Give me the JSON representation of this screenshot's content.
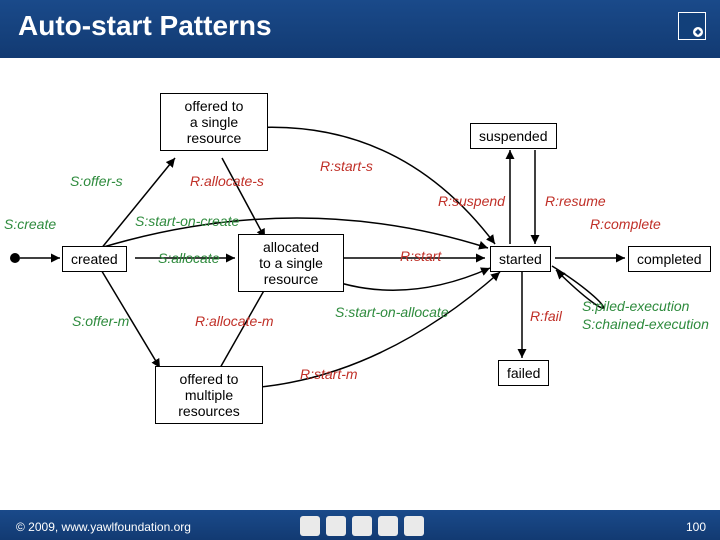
{
  "title": "Auto-start Patterns",
  "boxes": {
    "offered_single": "offered to\na single\nresource",
    "suspended": "suspended",
    "created": "created",
    "allocated_single": "allocated\nto a single\nresource",
    "started": "started",
    "completed": "completed",
    "offered_multiple": "offered to\nmultiple\nresources",
    "failed": "failed"
  },
  "labels": {
    "s_offer_s": "S:offer-s",
    "r_allocate_s": "R:allocate-s",
    "r_start_s": "R:start-s",
    "r_suspend": "R:suspend",
    "r_resume": "R:resume",
    "s_create": "S:create",
    "s_start_on_create": "S:start-on-create",
    "r_complete": "R:complete",
    "s_allocate": "S:allocate",
    "r_start": "R:start",
    "s_offer_m": "S:offer-m",
    "r_allocate_m": "R:allocate-m",
    "s_start_on_allocate": "S:start-on-allocate",
    "r_fail": "R:fail",
    "s_piled": "S:piled-execution",
    "s_chained": "S:chained-execution",
    "r_start_m": "R:start-m"
  },
  "footer": {
    "copyright": "© 2009, www.yawlfoundation.org",
    "page": "100"
  },
  "colors": {
    "s_label": "#2e8b3d",
    "r_label": "#c03028",
    "banner": "#1a4a8a"
  }
}
